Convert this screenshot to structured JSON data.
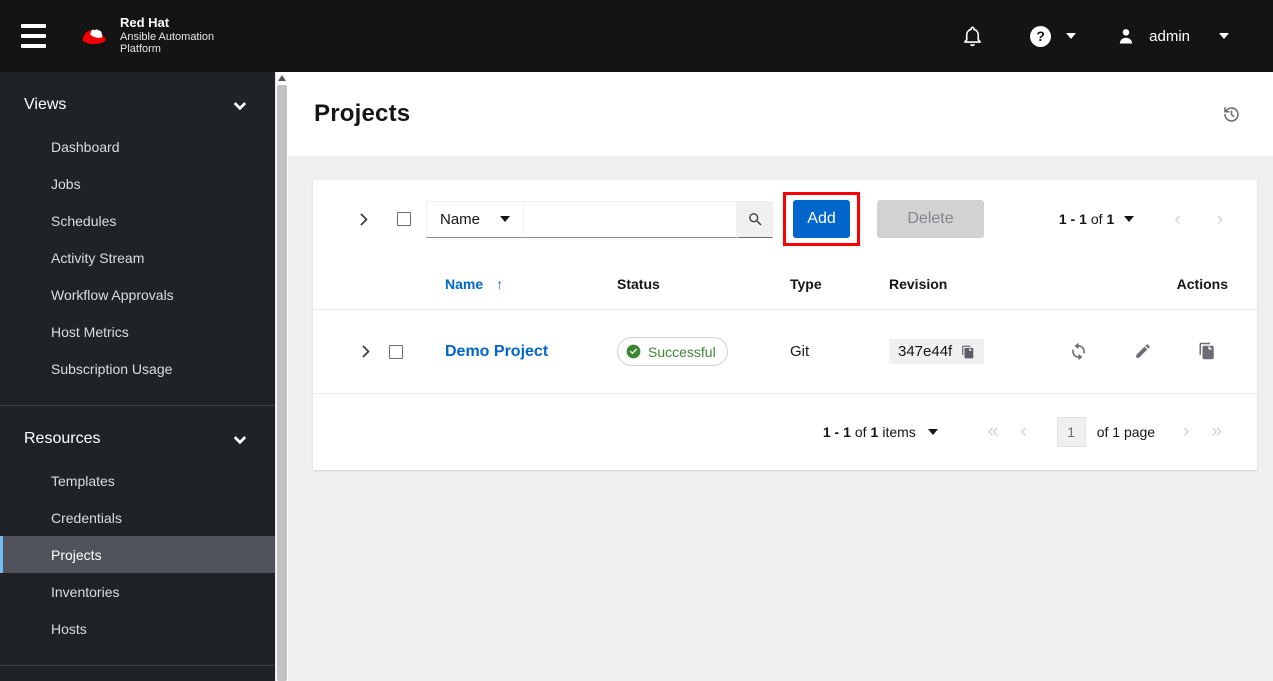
{
  "masthead": {
    "brand": {
      "name": "Red Hat",
      "product_line1": "Ansible Automation",
      "product_line2": "Platform"
    },
    "username": "admin"
  },
  "sidebar": {
    "groups": [
      {
        "label": "Views",
        "items": [
          {
            "label": "Dashboard"
          },
          {
            "label": "Jobs"
          },
          {
            "label": "Schedules"
          },
          {
            "label": "Activity Stream"
          },
          {
            "label": "Workflow Approvals"
          },
          {
            "label": "Host Metrics"
          },
          {
            "label": "Subscription Usage"
          }
        ]
      },
      {
        "label": "Resources",
        "items": [
          {
            "label": "Templates"
          },
          {
            "label": "Credentials"
          },
          {
            "label": "Projects"
          },
          {
            "label": "Inventories"
          },
          {
            "label": "Hosts"
          }
        ]
      }
    ]
  },
  "page": {
    "title": "Projects"
  },
  "toolbar": {
    "filter": {
      "selected": "Name"
    },
    "search_value": "",
    "buttons": {
      "add": "Add",
      "delete": "Delete"
    },
    "pagination": {
      "range": "1 - 1",
      "of_word": "of",
      "total": "1",
      "prev": "‹",
      "next": "›"
    }
  },
  "table": {
    "columns": {
      "name": "Name",
      "status": "Status",
      "type": "Type",
      "revision": "Revision",
      "actions": "Actions"
    },
    "sort_arrow": "↑",
    "row": {
      "name": "Demo Project",
      "status": "Successful",
      "type": "Git",
      "revision": "347e44f"
    }
  },
  "pagination_footer": {
    "range": "1 - 1",
    "of_word": "of",
    "total": "1",
    "items_word": "items",
    "first": "«",
    "prev": "‹",
    "page": "1",
    "of_page": "of 1 page",
    "next": "›",
    "last": "»"
  },
  "colors": {
    "accent_blue": "#0066cc",
    "success_green": "#3e8635",
    "annotation_red": "#ff0000",
    "active_nav_indicator": "#73bcf7"
  }
}
